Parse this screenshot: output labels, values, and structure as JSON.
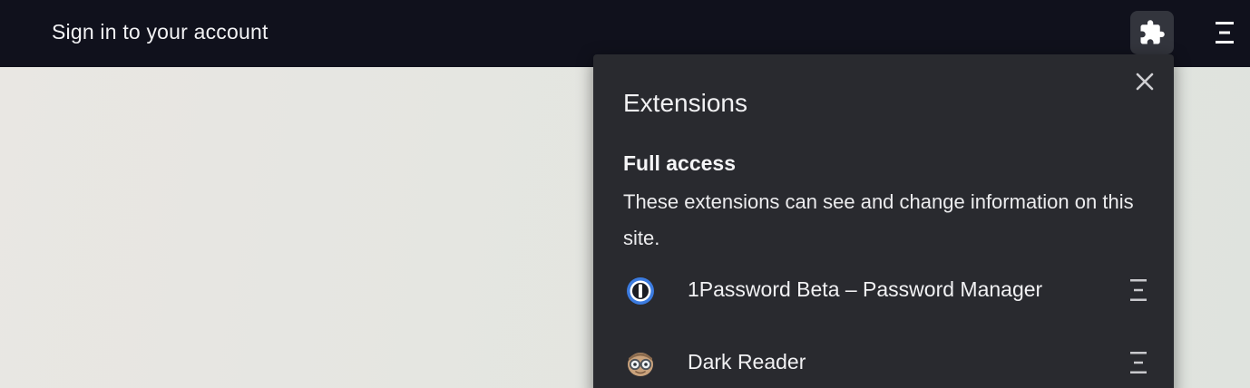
{
  "header": {
    "title": "Sign in to your account",
    "extensions_button_icon": "puzzle-piece-icon",
    "menu_icon": "menu-icon"
  },
  "extensions_popup": {
    "title": "Extensions",
    "close_icon": "close-icon",
    "section": {
      "heading": "Full access",
      "description": "These extensions can see and change information on this site."
    },
    "items": [
      {
        "name": "1Password Beta – Password Manager",
        "icon": "1password-icon",
        "menu_icon": "menu-icon"
      },
      {
        "name": "Dark Reader",
        "icon": "dark-reader-icon",
        "menu_icon": "menu-icon"
      }
    ]
  },
  "colors": {
    "topbar_bg": "#10111c",
    "popup_bg": "#292a2f",
    "page_bg": "#e6e6e2",
    "accent_blue": "#3b7be0"
  }
}
